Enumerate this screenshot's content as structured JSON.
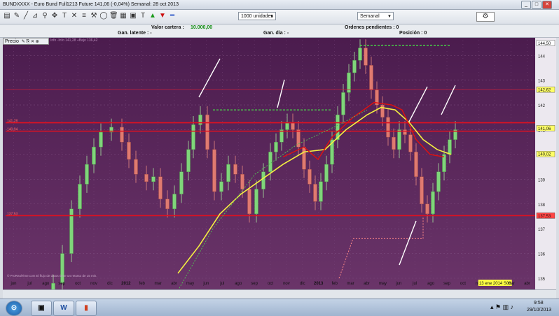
{
  "window": {
    "title": "BUNDXXXX - Euro Bund Full1213 Future   141,06 (-0,04%)   Semanal: 28 oct 2013",
    "controls": [
      "_",
      "□",
      "✕"
    ]
  },
  "toolbar": {
    "quantity": "1000 unidades",
    "period": "Semanal"
  },
  "info": {
    "valor_label": "Valor cartera :",
    "valor_value": "10.000,00",
    "ordenes": "Ordenes pendientes : 0",
    "posicion": "Posición : 0",
    "gan_latente": "Gan. latente : -",
    "gan_dia": "Gan. día : -"
  },
  "chart_header": {
    "label": "Precio",
    "legend": "Info  -Info 141,28  +Bajo 136,42"
  },
  "chart_data": {
    "type": "candlestick",
    "ylim": [
      135,
      144.6
    ],
    "y_ticks": [
      "144",
      "143",
      "142",
      "141",
      "140",
      "139",
      "138",
      "137",
      "136",
      "135"
    ],
    "price_labels": [
      {
        "value": 144.5,
        "text": "144,50",
        "color": "#ffffff"
      },
      {
        "value": 142.62,
        "text": "142,62",
        "color": "#ffff66"
      },
      {
        "value": 141.06,
        "text": "141,06",
        "color": "#ffff66"
      },
      {
        "value": 140.02,
        "text": "140,02",
        "color": "#ffff66"
      },
      {
        "value": 137.53,
        "text": "137,53",
        "color": "#ff4444"
      }
    ],
    "left_labels": [
      {
        "value": 141.28,
        "text": "141,28"
      },
      {
        "value": 140.94,
        "text": "140,94"
      },
      {
        "value": 137.53,
        "text": "137,53"
      }
    ],
    "hlines": [
      {
        "value": 141.28,
        "color": "#e01020"
      },
      {
        "value": 140.94,
        "color": "#e01020"
      },
      {
        "value": 137.53,
        "color": "#e01020"
      },
      {
        "value": 142.62,
        "color": "#c8203a"
      }
    ],
    "x_labels": [
      "jun",
      "jul",
      "ago",
      "sep",
      "oct",
      "nov",
      "dic",
      "2012",
      "feb",
      "mar",
      "abr",
      "may",
      "jun",
      "jul",
      "ago",
      "sep",
      "oct",
      "nov",
      "dic",
      "2013",
      "feb",
      "mar",
      "abr",
      "may",
      "jun",
      "jul",
      "ago",
      "sep",
      "oct",
      "nov",
      "13 ene 2014 S03",
      "mar",
      "abr"
    ],
    "footer": "© ProRealTime.com  El flujo de datos tiene un retraso de 15 min."
  },
  "taskbar": {
    "time": "9:58",
    "date": "29/10/2013",
    "apps": [
      "⊙",
      "▣",
      "W",
      "▮"
    ]
  }
}
